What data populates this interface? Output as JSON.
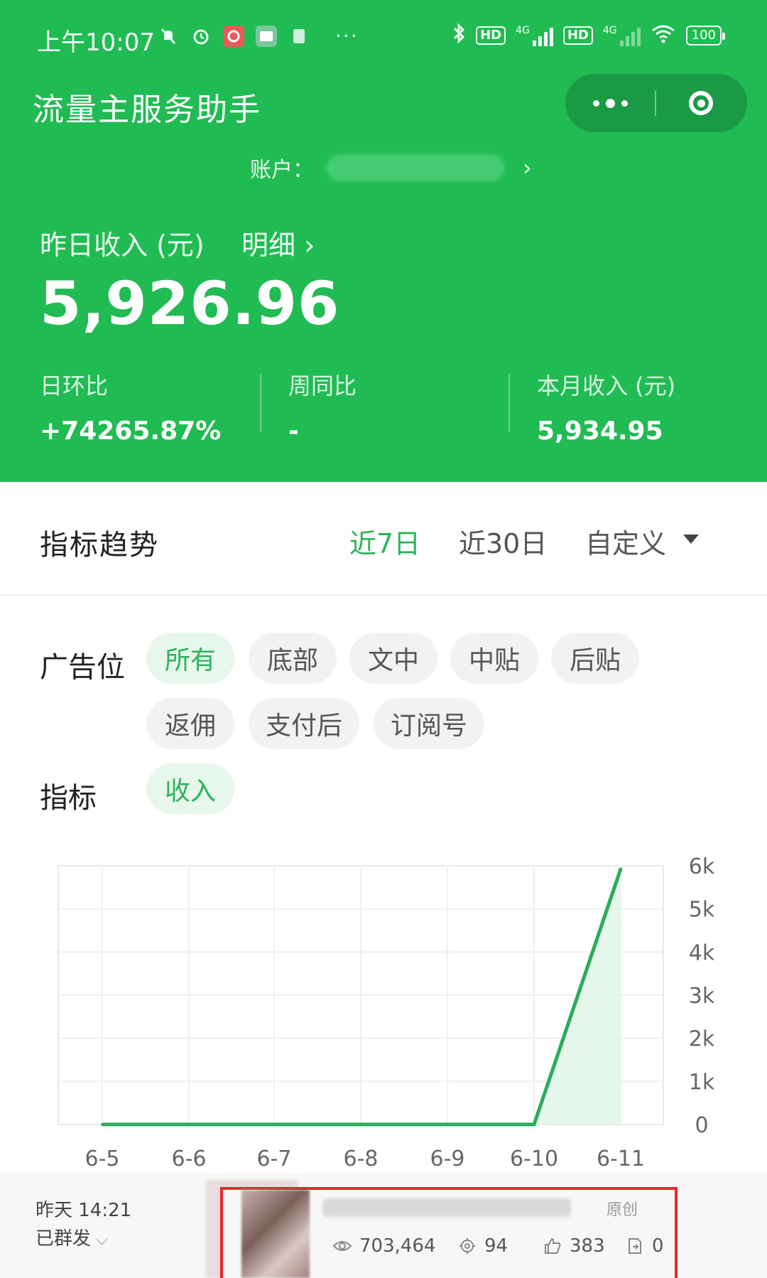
{
  "status_bar": {
    "time": "上午10:07",
    "hd_label": "HD",
    "network_label": "4G",
    "battery": "100"
  },
  "app": {
    "title": "流量主服务助手",
    "account_label": "账户："
  },
  "income": {
    "yesterday_label": "昨日收入 (元)",
    "detail_label": "明细 ›",
    "yesterday_value": "5,926.96",
    "stats": [
      {
        "label": "日环比",
        "value": "+74265.87%"
      },
      {
        "label": "周同比",
        "value": "-"
      },
      {
        "label": "本月收入 (元)",
        "value": "5,934.95"
      }
    ]
  },
  "trend": {
    "title": "指标趋势",
    "tabs": [
      "近7日",
      "近30日",
      "自定义"
    ],
    "active_tab": "近7日"
  },
  "filters": {
    "ad_position_label": "广告位",
    "ad_positions": [
      "所有",
      "底部",
      "文中",
      "中贴",
      "后贴",
      "返佣",
      "支付后",
      "订阅号"
    ],
    "active_ad_position": "所有",
    "metric_label": "指标",
    "metrics": [
      "收入"
    ],
    "active_metric": "收入"
  },
  "chart_data": {
    "type": "line",
    "categories": [
      "6-5",
      "6-6",
      "6-7",
      "6-8",
      "6-9",
      "6-10",
      "6-11"
    ],
    "series": [
      {
        "values": [
          0,
          0,
          0,
          0,
          0,
          0,
          5926.96
        ]
      }
    ],
    "yticks": [
      "0",
      "1k",
      "2k",
      "3k",
      "4k",
      "5k",
      "6k"
    ],
    "ylim": [
      0,
      6000
    ],
    "grid": true,
    "yaxis_position": "right",
    "line_color": "#2aac5a"
  },
  "message": {
    "time": "昨天 14:21",
    "status": "已群发",
    "original_tag": "原创",
    "reads": "703,464",
    "shares": "94",
    "likes": "383",
    "forwards": "0"
  },
  "colors": {
    "brand_green": "#21bb53",
    "accent_green": "#2bb45a",
    "highlight_red": "#e8272a"
  }
}
